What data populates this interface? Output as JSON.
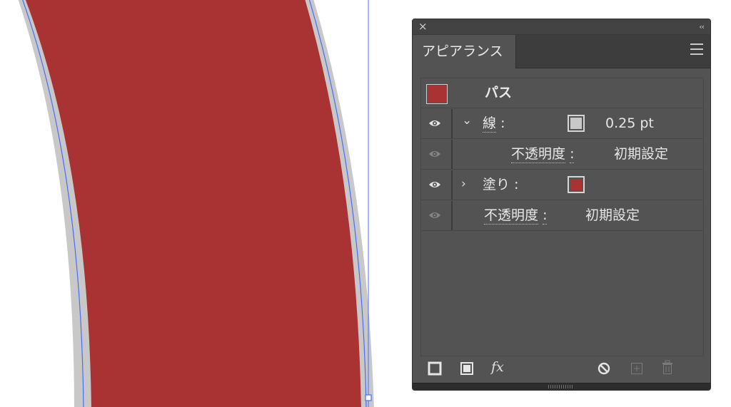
{
  "panel": {
    "tab_label": "アピアランス",
    "close_glyph": "×",
    "collapse_glyph": "‹‹",
    "object_label": "パス",
    "object_swatch_color": "#a93332",
    "stroke": {
      "label": "線",
      "colon": ":",
      "swatch_color": "#c8c8c8",
      "value": "0.25 pt",
      "expanded_glyph": "⌄",
      "opacity_label": "不透明度",
      "opacity_colon": ":",
      "opacity_value": "初期設定"
    },
    "fill": {
      "label": "塗り",
      "colon": ":",
      "swatch_color": "#a93332",
      "collapsed_glyph": "›"
    },
    "opacity": {
      "label": "不透明度",
      "colon": ":",
      "value": "初期設定"
    },
    "bottom_icons": [
      "add-stroke-icon",
      "add-fill-icon",
      "fx-icon",
      "clear-appearance-icon",
      "duplicate-item-icon",
      "delete-item-icon"
    ],
    "fx_label": "fx"
  },
  "canvas": {
    "shape_fill": "#a93332",
    "shape_outline": "#c8c8c8",
    "selection_color": "#4a6cf7"
  }
}
